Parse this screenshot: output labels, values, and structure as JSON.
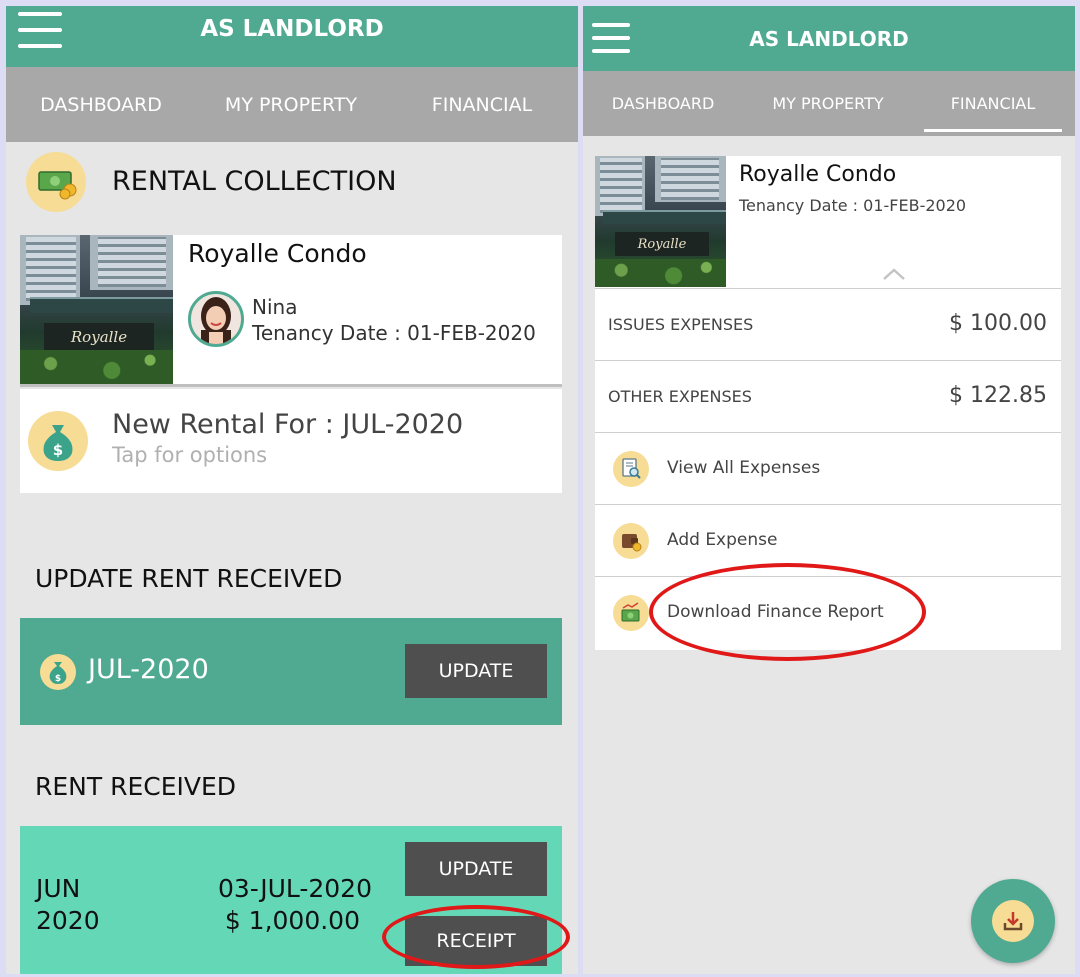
{
  "left": {
    "header": {
      "title": "AS LANDLORD"
    },
    "tabs": [
      "DASHBOARD",
      "MY PROPERTY",
      "FINANCIAL"
    ],
    "rental_collection": {
      "title": "RENTAL COLLECTION",
      "property": {
        "name": "Royalle Condo",
        "photo_sign": "Royalle",
        "tenant": "Nina",
        "tenancy_date": "Tenancy Date : 01-FEB-2020"
      },
      "new_rental": {
        "title": "New Rental For : JUL-2020",
        "subtitle": "Tap for options"
      }
    },
    "update_rent": {
      "heading": "UPDATE RENT RECEIVED",
      "month": "JUL-2020",
      "button": "UPDATE"
    },
    "rent_received": {
      "heading": "RENT RECEIVED",
      "month": "JUN",
      "year": "2020",
      "date": "03-JUL-2020",
      "amount": "$ 1,000.00",
      "update_button": "UPDATE",
      "receipt_button": "RECEIPT"
    }
  },
  "right": {
    "header": {
      "title": "AS LANDLORD"
    },
    "tabs": [
      "DASHBOARD",
      "MY PROPERTY",
      "FINANCIAL"
    ],
    "active_tab": "FINANCIAL",
    "property": {
      "name": "Royalle Condo",
      "photo_sign": "Royalle",
      "tenancy_date": "Tenancy Date : 01-FEB-2020"
    },
    "expenses": [
      {
        "label": "ISSUES EXPENSES",
        "value": "$ 100.00"
      },
      {
        "label": "OTHER EXPENSES",
        "value": "$ 122.85"
      }
    ],
    "actions": [
      {
        "label": "View All Expenses",
        "icon": "document-search-icon"
      },
      {
        "label": "Add Expense",
        "icon": "wallet-coin-icon"
      },
      {
        "label": "Download Finance Report",
        "icon": "money-chart-icon"
      }
    ],
    "fab_icon": "download-icon"
  },
  "colors": {
    "primary": "#4faa91",
    "tab_bar": "#a8a8a8",
    "rent_card": "#64d8b6",
    "button_dark": "#4f4f4f",
    "highlight_ring": "#e01818",
    "icon_bg": "#f7dc95"
  }
}
